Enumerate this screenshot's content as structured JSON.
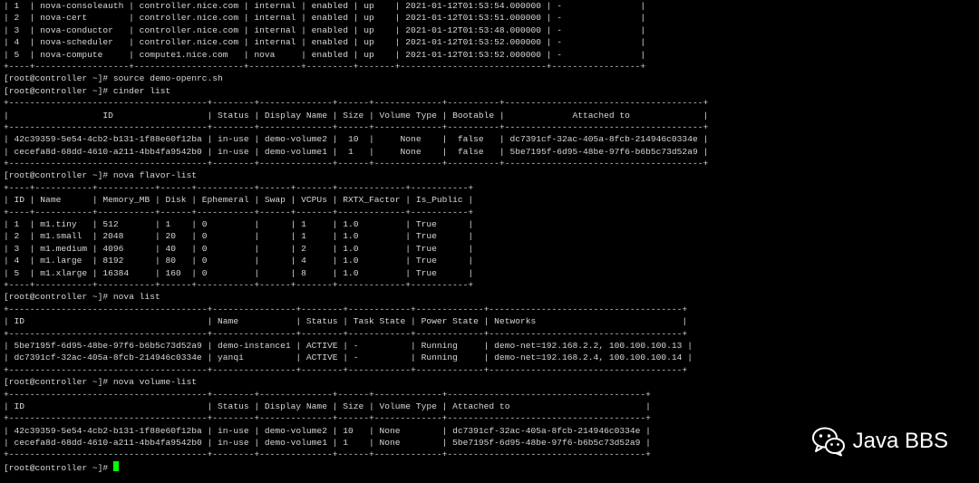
{
  "terminal": {
    "lines": [
      "| 1  | nova-consoleauth | controller.nice.com | internal | enabled | up    | 2021-01-12T01:53:54.000000 | -               |",
      "| 2  | nova-cert        | controller.nice.com | internal | enabled | up    | 2021-01-12T01:53:51.000000 | -               |",
      "| 3  | nova-conductor   | controller.nice.com | internal | enabled | up    | 2021-01-12T01:53:48.000000 | -               |",
      "| 4  | nova-scheduler   | controller.nice.com | internal | enabled | up    | 2021-01-12T01:53:52.000000 | -               |",
      "| 5  | nova-compute     | compute1.nice.com   | nova     | enabled | up    | 2021-01-12T01:53:52.000000 | -               |",
      "+----+------------------+---------------------+----------+---------+-------+----------------------------+-----------------+",
      "[root@controller ~]# source demo-openrc.sh",
      "[root@controller ~]# cinder list",
      "+--------------------------------------+--------+--------------+------+-------------+----------+--------------------------------------+",
      "|                  ID                  | Status | Display Name | Size | Volume Type | Bootable |             Attached to              |",
      "+--------------------------------------+--------+--------------+------+-------------+----------+--------------------------------------+",
      "| 42c39359-5e54-4cb2-b131-1f88e60f12ba | in-use | demo-volume2 |  10  |     None    |  false   | dc7391cf-32ac-405a-8fcb-214946c0334e |",
      "| cecefa8d-68dd-4610-a211-4bb4fa9542b0 | in-use | demo-volume1 |  1   |     None    |  false   | 5be7195f-6d95-48be-97f6-b6b5c73d52a9 |",
      "+--------------------------------------+--------+--------------+------+-------------+----------+--------------------------------------+",
      "[root@controller ~]# nova flavor-list",
      "+----+-----------+-----------+------+-----------+------+-------+-------------+-----------+",
      "| ID | Name      | Memory_MB | Disk | Ephemeral | Swap | VCPUs | RXTX_Factor | Is_Public |",
      "+----+-----------+-----------+------+-----------+------+-------+-------------+-----------+",
      "| 1  | m1.tiny   | 512       | 1    | 0         |      | 1     | 1.0         | True      |",
      "| 2  | m1.small  | 2048      | 20   | 0         |      | 1     | 1.0         | True      |",
      "| 3  | m1.medium | 4096      | 40   | 0         |      | 2     | 1.0         | True      |",
      "| 4  | m1.large  | 8192      | 80   | 0         |      | 4     | 1.0         | True      |",
      "| 5  | m1.xlarge | 16384     | 160  | 0         |      | 8     | 1.0         | True      |",
      "+----+-----------+-----------+------+-----------+------+-------+-------------+-----------+",
      "[root@controller ~]# nova list",
      "+--------------------------------------+----------------+--------+------------+-------------+-------------------------------------+",
      "| ID                                   | Name           | Status | Task State | Power State | Networks                            |",
      "+--------------------------------------+----------------+--------+------------+-------------+-------------------------------------+",
      "| 5be7195f-6d95-48be-97f6-b6b5c73d52a9 | demo-instance1 | ACTIVE | -          | Running     | demo-net=192.168.2.2, 100.100.100.13 |",
      "| dc7391cf-32ac-405a-8fcb-214946c0334e | yanqi          | ACTIVE | -          | Running     | demo-net=192.168.2.4, 100.100.100.14 |",
      "+--------------------------------------+----------------+--------+------------+-------------+-------------------------------------+",
      "[root@controller ~]# nova volume-list",
      "+--------------------------------------+--------+--------------+------+-------------+--------------------------------------+",
      "| ID                                   | Status | Display Name | Size | Volume Type | Attached to                          |",
      "+--------------------------------------+--------+--------------+------+-------------+--------------------------------------+",
      "| 42c39359-5e54-4cb2-b131-1f88e60f12ba | in-use | demo-volume2 | 10   | None        | dc7391cf-32ac-405a-8fcb-214946c0334e |",
      "| cecefa8d-68dd-4610-a211-4bb4fa9542b0 | in-use | demo-volume1 | 1    | None        | 5be7195f-6d95-48be-97f6-b6b5c73d52a9 |",
      "+--------------------------------------+--------+--------------+------+-------------+--------------------------------------+"
    ],
    "prompt": "[root@controller ~]# ",
    "cursor_color": "#00ff00",
    "foreground_color": "#d7d7d7",
    "background_color": "#000000"
  },
  "watermark": {
    "icon": "wechat-icon",
    "text": "Java BBS"
  }
}
